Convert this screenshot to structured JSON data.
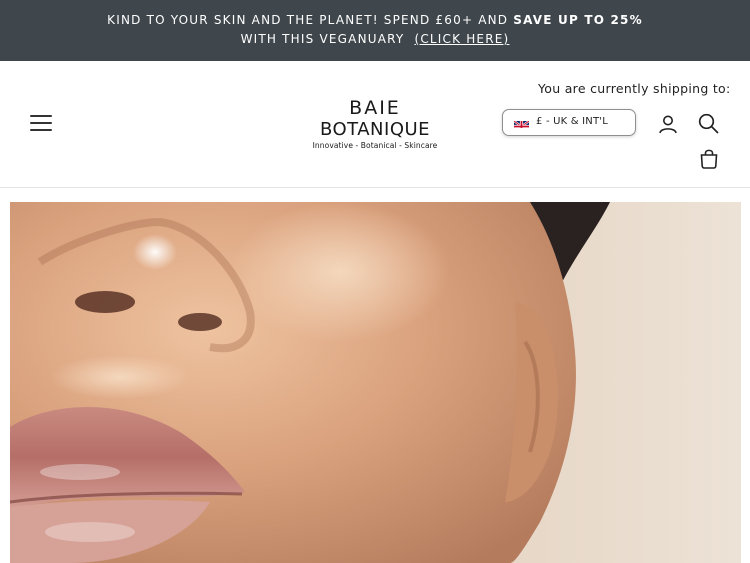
{
  "announcement": {
    "text_part1": "KIND TO YOUR SKIN AND THE PLANET! SPEND £60+ AND ",
    "text_bold": "SAVE UP TO 25%",
    "text_line2": "WITH THIS VEGANUARY",
    "cta": "(CLICK HERE)"
  },
  "header": {
    "menu_icon": "hamburger-menu-icon",
    "logo": {
      "line1": "BAIE",
      "line2": "BOTANIQUE",
      "tagline": "Innovative - Botanical - Skincare"
    },
    "shipping_label": "You are currently shipping to:",
    "currency_selector": {
      "flag_icon": "uk-flag-icon",
      "label": "£ - UK & INT'L"
    },
    "icons": [
      "account-icon",
      "search-icon",
      "bag-icon"
    ]
  },
  "hero": {
    "image": "close-up of glowing skin with glossy pink lips",
    "colors": {
      "background": "#e8d8c6",
      "skin": "#d9a17f",
      "lips": "#c98e86"
    }
  },
  "colors": {
    "announcement_bg": "#3f474d",
    "announcement_text": "#ffffff",
    "text": "#1c1c1c"
  }
}
